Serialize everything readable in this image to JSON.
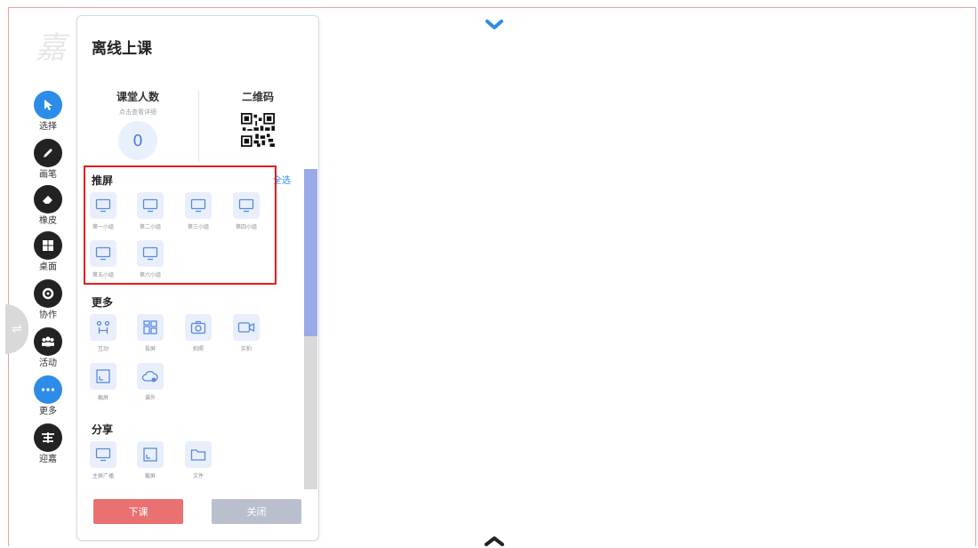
{
  "background_text": "嘉",
  "toolbar": {
    "items": [
      {
        "label": "选择",
        "icon": "cursor-icon",
        "active": true
      },
      {
        "label": "画笔",
        "icon": "pen-icon",
        "active": false
      },
      {
        "label": "橡皮",
        "icon": "eraser-icon",
        "active": false
      },
      {
        "label": "桌面",
        "icon": "windows-icon",
        "active": false
      },
      {
        "label": "协作",
        "icon": "collaborate-icon",
        "active": false
      },
      {
        "label": "活动",
        "icon": "group-icon",
        "active": false
      },
      {
        "label": "更多",
        "icon": "more-icon",
        "active": true
      },
      {
        "label": "迎嘉",
        "icon": "yingjia-logo-icon",
        "active": false
      }
    ]
  },
  "panel": {
    "title": "离线上课",
    "classroom": {
      "title": "课堂人数",
      "subtitle": "点击查看详细",
      "count": "0"
    },
    "qrcode": {
      "title": "二维码"
    },
    "push_screen": {
      "title": "推屏",
      "select_all": "全选",
      "groups": [
        "第一小组",
        "第二小组",
        "第三小组",
        "第四小组",
        "第五小组",
        "第六小组"
      ]
    },
    "more": {
      "title": "更多",
      "items": [
        {
          "label": "互动",
          "icon": "interact-icon"
        },
        {
          "label": "投屏",
          "icon": "grid-icon"
        },
        {
          "label": "拍照",
          "icon": "camera-icon"
        },
        {
          "label": "实拍",
          "icon": "video-icon"
        },
        {
          "label": "截屏",
          "icon": "crop-icon"
        },
        {
          "label": "课外",
          "icon": "cloud-icon"
        }
      ]
    },
    "share": {
      "title": "分享",
      "items": [
        {
          "label": "主屏广播",
          "icon": "monitor-icon"
        },
        {
          "label": "截屏",
          "icon": "crop-icon"
        },
        {
          "label": "文件",
          "icon": "folder-icon"
        }
      ]
    },
    "buttons": {
      "end_class": "下课",
      "close": "关闭"
    }
  },
  "colors": {
    "accent": "#2d8ce8",
    "highlight": "#e51c1c",
    "end_class": "#ea7171",
    "close": "#b9bfcc"
  }
}
